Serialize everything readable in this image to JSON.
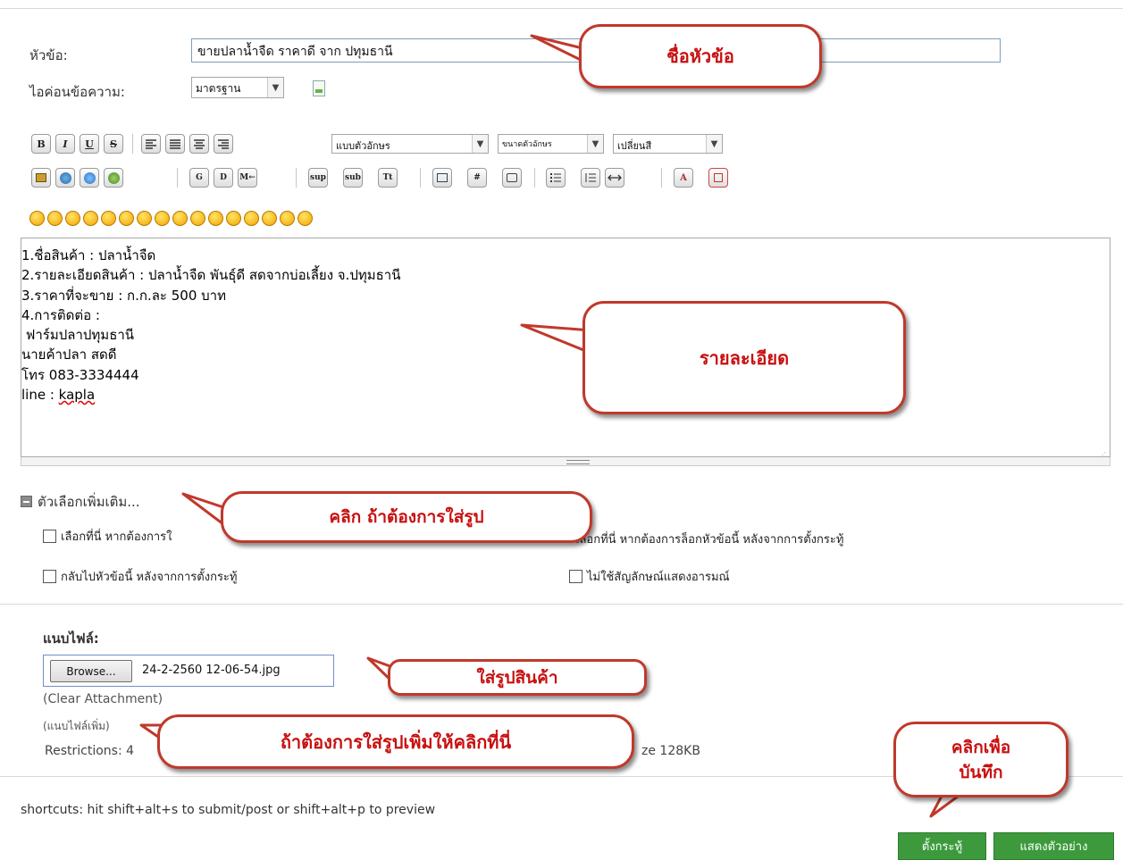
{
  "form": {
    "subject_label": "หัวข้อ:",
    "subject_value": "ขายปลาน้ำจืด ราคาดี จาก ปทุมธานี",
    "icon_label": "ไอค่อนข้อความ:",
    "icon_select": "มาตรฐาน"
  },
  "toolbar": {
    "font_select": "แบบตัวอักษร",
    "size_select": "ขนาดตัวอักษร",
    "color_select": "เปลี่ยนสี",
    "buttons_row1": [
      "B",
      "I",
      "U",
      "S"
    ],
    "buttons_row2_text": [
      "G",
      "D",
      "M←",
      "sup",
      "sub",
      "Tt",
      "#"
    ]
  },
  "editor": {
    "lines": [
      "1.ชื่อสินค้า : ปลาน้ำจืด",
      "2.รายละเอียดสินค้า : ปลาน้ำจืด พันธุ์ดี สดจากบ่อเลี้ยง จ.ปทุมธานี",
      "3.ราคาที่จะขาย : ก.ก.ละ 500 บาท",
      "4.การติดต่อ :",
      " ฟาร์มปลาปทุมธานี",
      "นายค้าปลา สดดี",
      "โทร 083-3334444",
      "line : kapla"
    ]
  },
  "options": {
    "title": "ตัวเลือกเพิ่มเติม...",
    "check1": "เลือกที่นี่ หากต้องการใ",
    "check2": "เลือกที่นี่ หากต้องการล็อกหัวข้อนี้ หลังจากการตั้งกระทู้",
    "check3": "กลับไปหัวข้อนี้ หลังจากการตั้งกระทู้",
    "check4": "ไม่ใช้สัญลักษณ์แสดงอารมณ์"
  },
  "attachments": {
    "label": "แนบไฟล์:",
    "browse": "Browse...",
    "file_name": "24-2-2560 12-06-54.jpg",
    "clear": "(Clear Attachment)",
    "more": "(แนบไฟล์เพิ่ม)",
    "restrictions_start": "Restrictions: 4",
    "restrictions_end": "ze 128KB"
  },
  "footer": {
    "shortcuts": "shortcuts: hit shift+alt+s to submit/post or shift+alt+p to preview",
    "post_button": "ตั้งกระทู้",
    "preview_button": "แสดงตัวอย่าง"
  },
  "callouts": {
    "subject": "ชื่อหัวข้อ",
    "details": "รายละเอียด",
    "click_picture": "คลิก ถ้าต้องการใส่รูป",
    "product_picture": "ใส่รูปสินค้า",
    "more_picture": "ถ้าต้องการใส่รูปเพิ่มให้คลิกที่นี่",
    "save_line1": "คลิกเพื่อ",
    "save_line2": "บันทึก"
  },
  "colors": {
    "callout_text": "#c81010",
    "callout_border": "#c0392b",
    "button_green": "#3c9a3c"
  }
}
